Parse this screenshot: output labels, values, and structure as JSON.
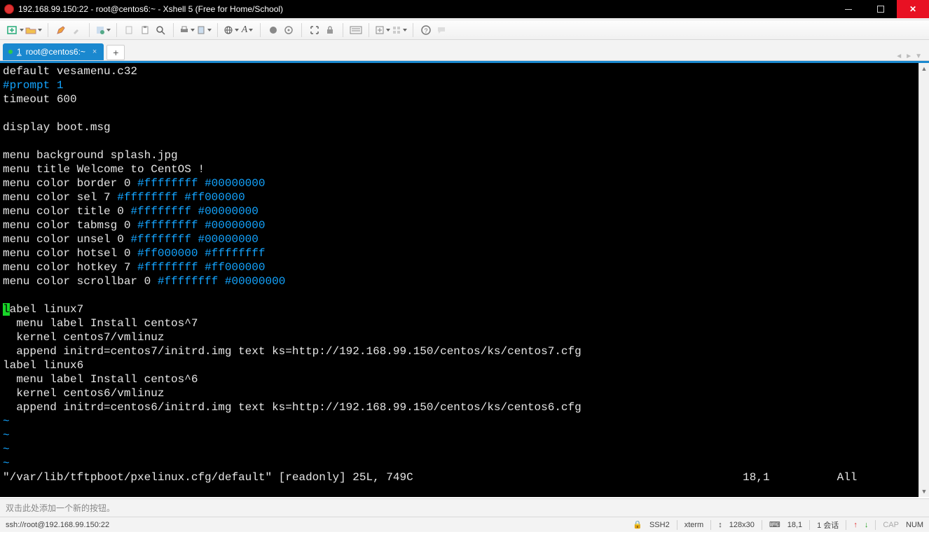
{
  "window": {
    "title": "192.168.99.150:22 - root@centos6:~ - Xshell 5 (Free for Home/School)"
  },
  "toolbar": {
    "icons": {
      "new": "new-session-icon",
      "open": "open-icon",
      "edit": "pencil-icon",
      "eyedrop": "eyedropper-icon",
      "props": "properties-icon",
      "copy": "copy-icon",
      "paste": "paste-icon",
      "find": "find-icon",
      "print": "print-icon",
      "xfer": "transfer-icon",
      "globe": "globe-icon",
      "font": "font-icon",
      "c1": "circle-icon",
      "c2": "target-icon",
      "full": "fullscreen-icon",
      "lock": "lock-icon",
      "kbd": "keyboard-icon",
      "add": "add-panel-icon",
      "grid": "layout-icon",
      "help": "help-icon",
      "chat": "chat-icon"
    }
  },
  "tab": {
    "index": "1",
    "label": "root@centos6:~"
  },
  "terminal": {
    "lines": [
      {
        "t": "plain",
        "v": "default vesamenu.c32"
      },
      {
        "t": "blue",
        "v": "#prompt 1"
      },
      {
        "t": "plain",
        "v": "timeout 600"
      },
      {
        "t": "plain",
        "v": ""
      },
      {
        "t": "plain",
        "v": "display boot.msg"
      },
      {
        "t": "plain",
        "v": ""
      },
      {
        "t": "plain",
        "v": "menu background splash.jpg"
      },
      {
        "t": "plain",
        "v": "menu title Welcome to CentOS !"
      },
      {
        "t": "color",
        "pre": "menu color border 0 ",
        "c1": "#ffffffff",
        "mid": " ",
        "c2": "#00000000"
      },
      {
        "t": "color",
        "pre": "menu color sel 7 ",
        "c1": "#ffffffff",
        "mid": " ",
        "c2": "#ff000000"
      },
      {
        "t": "color",
        "pre": "menu color title 0 ",
        "c1": "#ffffffff",
        "mid": " ",
        "c2": "#00000000"
      },
      {
        "t": "color",
        "pre": "menu color tabmsg 0 ",
        "c1": "#ffffffff",
        "mid": " ",
        "c2": "#00000000"
      },
      {
        "t": "color",
        "pre": "menu color unsel 0 ",
        "c1": "#ffffffff",
        "mid": " ",
        "c2": "#00000000"
      },
      {
        "t": "color",
        "pre": "menu color hotsel 0 ",
        "c1": "#ff000000",
        "mid": " ",
        "c2": "#ffffffff"
      },
      {
        "t": "color",
        "pre": "menu color hotkey 7 ",
        "c1": "#ffffffff",
        "mid": " ",
        "c2": "#ff000000"
      },
      {
        "t": "color",
        "pre": "menu color scrollbar 0 ",
        "c1": "#ffffffff",
        "mid": " ",
        "c2": "#00000000"
      },
      {
        "t": "plain",
        "v": ""
      },
      {
        "t": "cursor",
        "cur": "l",
        "rest": "abel linux7"
      },
      {
        "t": "plain",
        "v": "  menu label Install centos^7"
      },
      {
        "t": "plain",
        "v": "  kernel centos7/vmlinuz"
      },
      {
        "t": "plain",
        "v": "  append initrd=centos7/initrd.img text ks=http://192.168.99.150/centos/ks/centos7.cfg"
      },
      {
        "t": "plain",
        "v": "label linux6"
      },
      {
        "t": "plain",
        "v": "  menu label Install centos^6"
      },
      {
        "t": "plain",
        "v": "  kernel centos6/vmlinuz"
      },
      {
        "t": "plain",
        "v": "  append initrd=centos6/initrd.img text ks=http://192.168.99.150/centos/ks/centos6.cfg"
      },
      {
        "t": "tilde",
        "v": "~"
      },
      {
        "t": "tilde",
        "v": "~"
      },
      {
        "t": "tilde",
        "v": "~"
      },
      {
        "t": "tilde",
        "v": "~"
      }
    ],
    "status_left": "\"/var/lib/tftpboot/pxelinux.cfg/default\" [readonly] 25L, 749C",
    "status_pos": "18,1",
    "status_right": "All"
  },
  "quickbar": {
    "hint": "双击此处添加一个新的按钮。"
  },
  "statusbar": {
    "address": "ssh://root@192.168.99.150:22",
    "proto": "SSH2",
    "term": "xterm",
    "size": "128x30",
    "rows": "18,1",
    "sessions": "1 会话",
    "caps": "CAP",
    "num": "NUM"
  }
}
